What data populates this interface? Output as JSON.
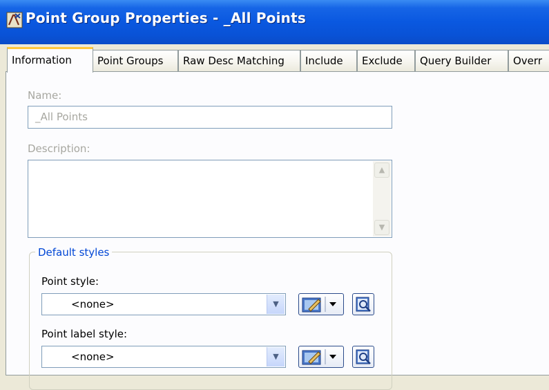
{
  "window": {
    "title": "Point Group Properties - _All Points"
  },
  "tabs": [
    {
      "label": "Information",
      "active": true
    },
    {
      "label": "Point Groups",
      "active": false
    },
    {
      "label": "Raw Desc Matching",
      "active": false
    },
    {
      "label": "Include",
      "active": false
    },
    {
      "label": "Exclude",
      "active": false
    },
    {
      "label": "Query Builder",
      "active": false
    },
    {
      "label": "Overr",
      "active": false
    }
  ],
  "form": {
    "name_label": "Name:",
    "name_value": "_All Points",
    "description_label": "Description:",
    "description_value": ""
  },
  "default_styles": {
    "title": "Default styles",
    "point_style_label": "Point style:",
    "point_style_value": "<none>",
    "point_label_style_label": "Point label style:",
    "point_label_style_value": "<none>"
  },
  "colors": {
    "titlebar": "#0a58e0",
    "active_tab_accent": "#ffc83c",
    "group_title": "#0046d5",
    "disabled_text": "#a7a7a0"
  },
  "icons": {
    "app": "civil3d-app-icon",
    "edit": "edit-style-icon",
    "preview": "preview-icon"
  }
}
